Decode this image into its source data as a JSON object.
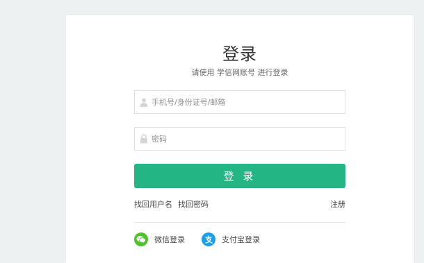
{
  "login": {
    "title": "登录",
    "subtitle": "请使用 学信网账号 进行登录",
    "username_placeholder": "手机号/身份证号/邮箱",
    "password_placeholder": "密码",
    "submit_label": "登 录",
    "forgot_username": "找回用户名",
    "forgot_password": "找回密码",
    "register": "注册"
  },
  "social": {
    "wechat_label": "微信登录",
    "alipay_label": "支付宝登录"
  },
  "colors": {
    "accent": "#23b584",
    "wechat": "#50c22e",
    "alipay": "#1aa0e6",
    "page_bg": "#eef1f1"
  },
  "icons": {
    "username": "user-icon",
    "password": "lock-icon",
    "wechat": "wechat-icon",
    "alipay": "alipay-icon"
  }
}
